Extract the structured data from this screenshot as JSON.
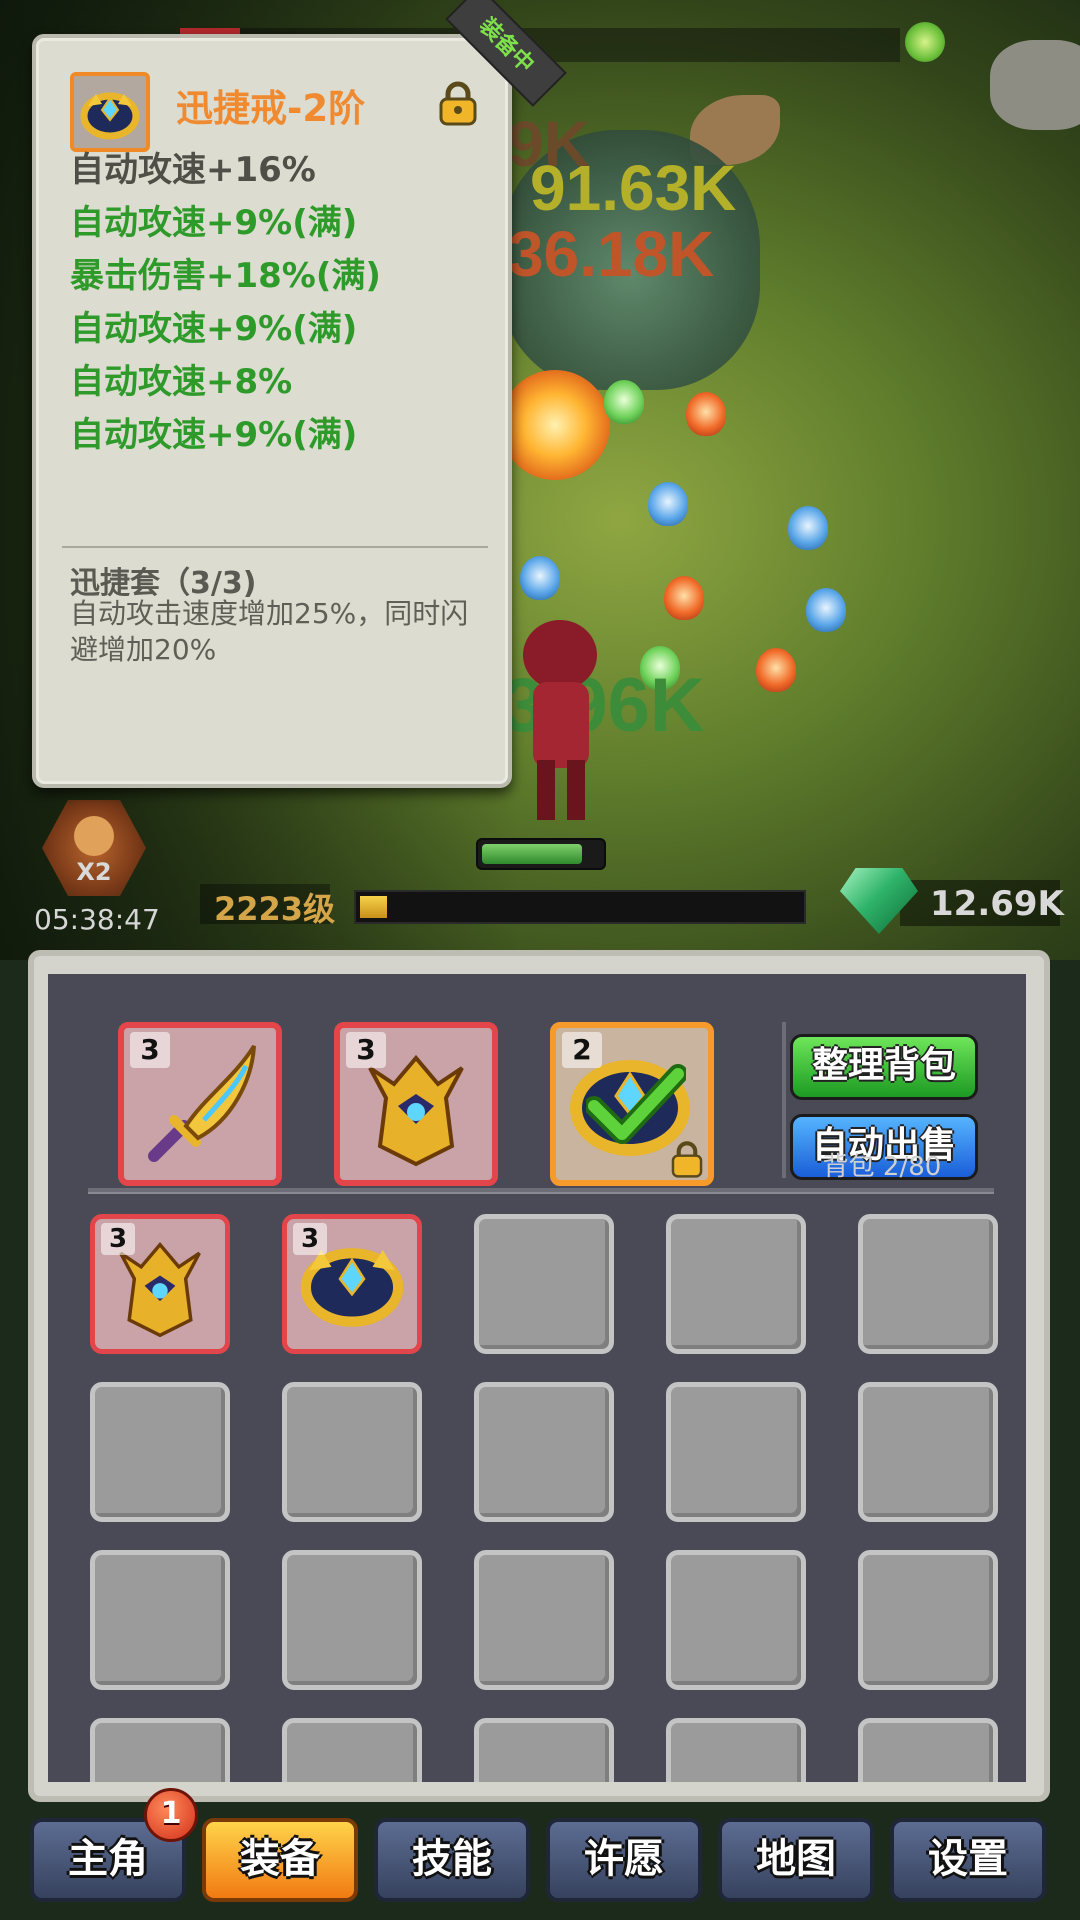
{
  "battle": {
    "damage_numbers": [
      {
        "text": "9K",
        "color": "#6b4a2a"
      },
      {
        "text": "91.63K",
        "color": "#b4b02a"
      },
      {
        "text": "36.18K",
        "color": "#c0552a"
      },
      {
        "text": "3.96K",
        "color": "#3c8c3a"
      }
    ]
  },
  "hud": {
    "multiplier": "X2",
    "timer": "05:38:47",
    "level": "2223级",
    "xp_progress": 0.03,
    "hero_hp": 0.85,
    "gems": "12.69K"
  },
  "tooltip": {
    "equipped_tag": "装备中",
    "item_name": "迅捷戒-2阶",
    "stats": [
      {
        "text": "自动攻速+16%",
        "color": "#4f4f48"
      },
      {
        "text": "自动攻速+9%(满)",
        "color": "#2e9a2a"
      },
      {
        "text": "暴击伤害+18%(满)",
        "color": "#2e9a2a"
      },
      {
        "text": "自动攻速+9%(满)",
        "color": "#2e9a2a"
      },
      {
        "text": "自动攻速+8%",
        "color": "#2e9a2a"
      },
      {
        "text": "自动攻速+9%(满)",
        "color": "#2e9a2a"
      }
    ],
    "set_name": "迅捷套（3/3)",
    "set_description": "自动攻击速度增加25%，同时闪避增加20%"
  },
  "inventory": {
    "equipped": [
      {
        "item": "sword",
        "tier": "3",
        "rarity": "red"
      },
      {
        "item": "helmet",
        "tier": "3",
        "rarity": "red"
      },
      {
        "item": "ring",
        "tier": "2",
        "rarity": "orange",
        "selected": true,
        "locked": true
      }
    ],
    "sort_button": "整理背包",
    "auto_sell_button": "自动出售",
    "bag_count": "背包 2/80",
    "bag_items": [
      {
        "item": "helmet",
        "tier": "3"
      },
      {
        "item": "ring",
        "tier": "3"
      }
    ]
  },
  "tabs": [
    {
      "label": "主角",
      "active": false,
      "badge": "1"
    },
    {
      "label": "装备",
      "active": true
    },
    {
      "label": "技能",
      "active": false
    },
    {
      "label": "许愿",
      "active": false
    },
    {
      "label": "地图",
      "active": false
    },
    {
      "label": "设置",
      "active": false
    }
  ],
  "colors": {
    "title_orange": "#f08a30",
    "stat_green": "#2e9a2a",
    "rarity_red": "#e2464a",
    "rarity_orange": "#f79a2c"
  }
}
